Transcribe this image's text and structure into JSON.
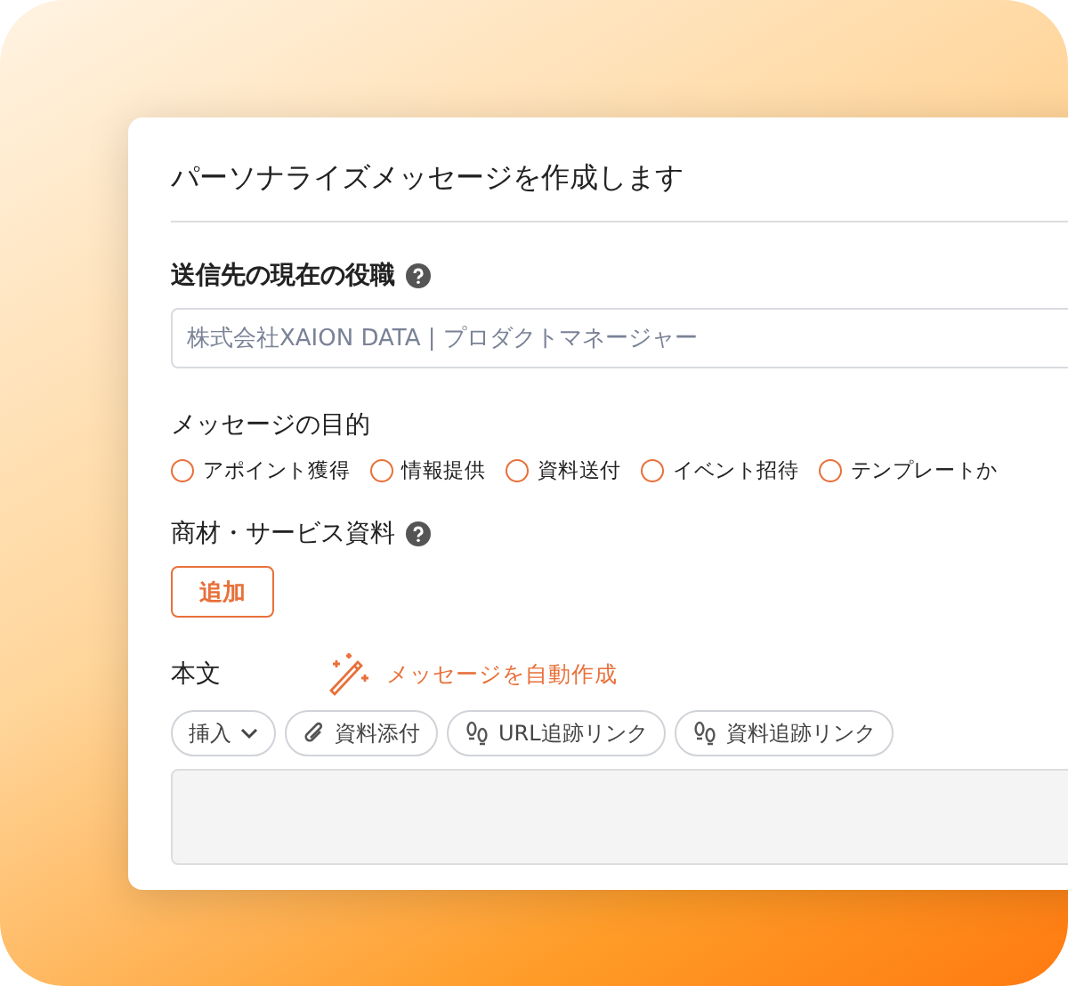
{
  "dialog": {
    "title": "パーソナライズメッセージを作成します"
  },
  "role_field": {
    "label": "送信先の現在の役職",
    "placeholder": "株式会社XAION DATA | プロダクトマネージャー"
  },
  "purpose": {
    "label": "メッセージの目的",
    "options": [
      {
        "label": "アポイント獲得",
        "selected": false
      },
      {
        "label": "情報提供",
        "selected": false
      },
      {
        "label": "資料送付",
        "selected": false
      },
      {
        "label": "イベント招待",
        "selected": false
      },
      {
        "label": "テンプレートか",
        "selected": false
      }
    ]
  },
  "materials": {
    "label": "商材・サービス資料",
    "add_button": "追加"
  },
  "body": {
    "label": "本文",
    "auto_button": "メッセージを自動作成",
    "toolbar": [
      {
        "kind": "dropdown",
        "label": "挿入"
      },
      {
        "kind": "attach",
        "label": "資料添付"
      },
      {
        "kind": "track",
        "label": "URL追跡リンク"
      },
      {
        "kind": "track",
        "label": "資料追跡リンク"
      }
    ]
  }
}
